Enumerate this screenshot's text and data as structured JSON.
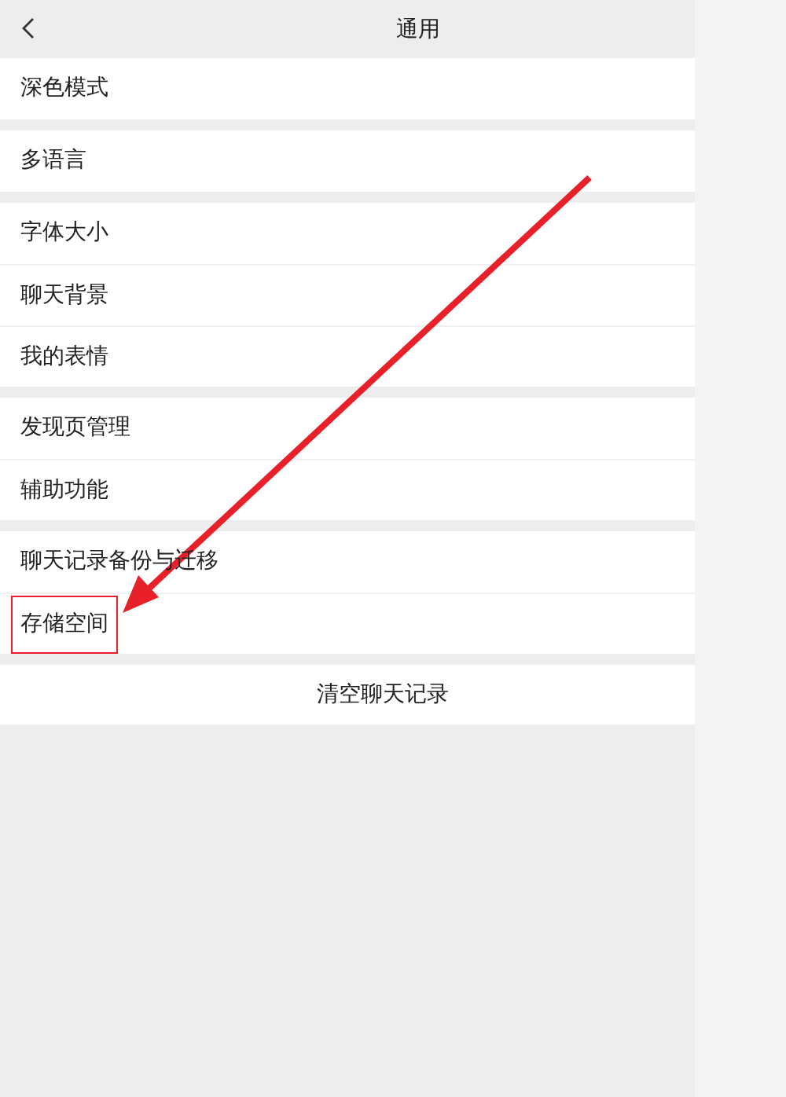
{
  "header": {
    "title": "通用"
  },
  "groups": [
    {
      "items": [
        {
          "label": "深色模式",
          "highlighted": false
        }
      ]
    },
    {
      "items": [
        {
          "label": "多语言",
          "highlighted": false
        }
      ]
    },
    {
      "items": [
        {
          "label": "字体大小",
          "highlighted": false
        },
        {
          "label": "聊天背景",
          "highlighted": false
        },
        {
          "label": "我的表情",
          "highlighted": false
        }
      ]
    },
    {
      "items": [
        {
          "label": "发现页管理",
          "highlighted": false
        },
        {
          "label": "辅助功能",
          "highlighted": false
        }
      ]
    },
    {
      "items": [
        {
          "label": "聊天记录备份与迁移",
          "highlighted": false
        },
        {
          "label": "存储空间",
          "highlighted": true
        }
      ]
    }
  ],
  "clear_button": {
    "label": "清空聊天记录"
  }
}
